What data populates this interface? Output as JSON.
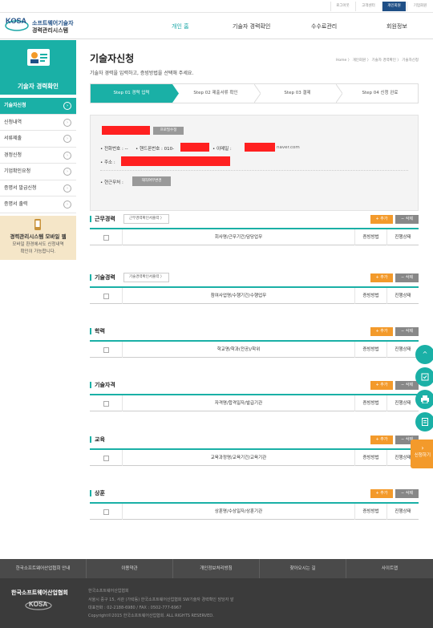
{
  "util": {
    "login": "로그아웃",
    "center": "고객센터",
    "personal": "개인회원",
    "corporate": "기업회원"
  },
  "header": {
    "logo_mark": "KOSA",
    "logo_line1": "소프트웨어기술자",
    "logo_line2": "경력관리시스템",
    "nav": [
      "개인 홈",
      "기술자 경력확인",
      "수수료관리",
      "회원정보"
    ]
  },
  "sidebar": {
    "title": "기술자 경력확인",
    "items": [
      "기술자신청",
      "신청내역",
      "서류제출",
      "경정신청",
      "기업확인요청",
      "증명서 발급신청",
      "증명서 출력"
    ],
    "mobile_title": "경력관리시스템 모바일 웹",
    "mobile_desc1": "모바일 환경에서도 신청내역",
    "mobile_desc2": "확인이 가능합니다."
  },
  "page": {
    "title": "기술자신청",
    "subtitle": "기술자 경력을 입력하고, 증빙방법을 선택해 주세요.",
    "breadcrumb": "Home 〉 개인회원 〉 기술자 경력확인 〉 기술자신청"
  },
  "steps": [
    "Step 01 경력 입력",
    "Step 02 제출서류 확인",
    "Step 03 결제",
    "Step 04 신청 완료"
  ],
  "profile": {
    "edit_btn": "프로필수정",
    "phone_label": "• 전화번호 : --",
    "mobile_label": "• 핸드폰번호 : 010-",
    "email_label": "• 이메일 :",
    "email_domain": "naver.com",
    "address_label": "• 주소 :",
    "status_label": "• 현근무처 :",
    "status_btn": "재직여부변경"
  },
  "common": {
    "add": "+ 추가",
    "delete": "− 삭제",
    "col_proof": "증빙방법",
    "col_status": "진행상태"
  },
  "sections": [
    {
      "title": "근무경력",
      "cert": "근무경력확인서출력  〉",
      "col": "회사명/근무기간/담당업무"
    },
    {
      "title": "기술경력",
      "cert": "기술경력확인서출력  〉",
      "col": "참여사업명/수행기간/수행업무"
    },
    {
      "title": "학력",
      "col": "학교명/학과(전공)/학위"
    },
    {
      "title": "기술자격",
      "col": "자격명/합격일자/발급기관"
    },
    {
      "title": "교육",
      "col": "교육과정명/교육기간/교육기관"
    },
    {
      "title": "상훈",
      "col": "상훈명/수상일자/상훈기관"
    }
  ],
  "floating": {
    "up": "^",
    "apply": "신청하기"
  },
  "footer": {
    "links": [
      "한국소프트웨어산업협회 안내",
      "이용약관",
      "개인정보처리방침",
      "찾아오시는 길",
      "사이트맵"
    ],
    "org": "한국소프트웨어산업협회",
    "logo": "KOSA",
    "line1": "한국소프트웨어산업협회",
    "line2": "서울시 중구 15, 서관 (가락동) 한국소프트웨어산업협회 SW기술자 경력확인 담당자 앞",
    "line3": "대표전화 : 02-2188-6980 / FAX : 0502-777-6967",
    "line4": "Copyright©2015 한국소프트웨어산업협회. ALL RIGHTS RESERVED."
  }
}
